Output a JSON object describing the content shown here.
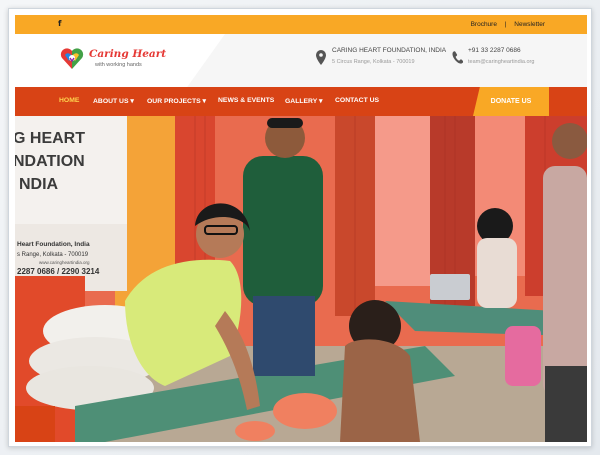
{
  "topbar": {
    "social_icon": "f",
    "brochure": "Brochure",
    "separator": "|",
    "newsletter": "Newsletter"
  },
  "logo": {
    "title": "Caring Heart",
    "tagline": "with working hands",
    "icon": "heart-hands-logo"
  },
  "contact": {
    "address_title": "CARING HEART FOUNDATION, INDIA",
    "address_detail": "5 Circus Range, Kolkata - 700019",
    "phone": "+91 33 2287 0686",
    "email": "team@caringheartindia.org"
  },
  "nav": {
    "items": [
      {
        "label": "HOME"
      },
      {
        "label": "ABOUT US ▾"
      },
      {
        "label": "OUR PROJECTS ▾"
      },
      {
        "label": "NEWS & EVENTS"
      },
      {
        "label": "GALLERY ▾"
      },
      {
        "label": "CONTACT US"
      }
    ],
    "donate": "DONATE US"
  },
  "hero": {
    "banner_line1": "G HEART",
    "banner_line2": "NDATION",
    "banner_line3": "NDIA",
    "banner_small1": "Heart Foundation, India",
    "banner_small2": "s Range, Kolkata - 700019",
    "banner_small3": "www.caringheartindia.org",
    "banner_phone": "2287 0686 / 2290 3214"
  },
  "colors": {
    "topbar": "#f9a825",
    "nav": "#d84315",
    "donate": "#f9a825",
    "brand_red": "#e53935"
  }
}
